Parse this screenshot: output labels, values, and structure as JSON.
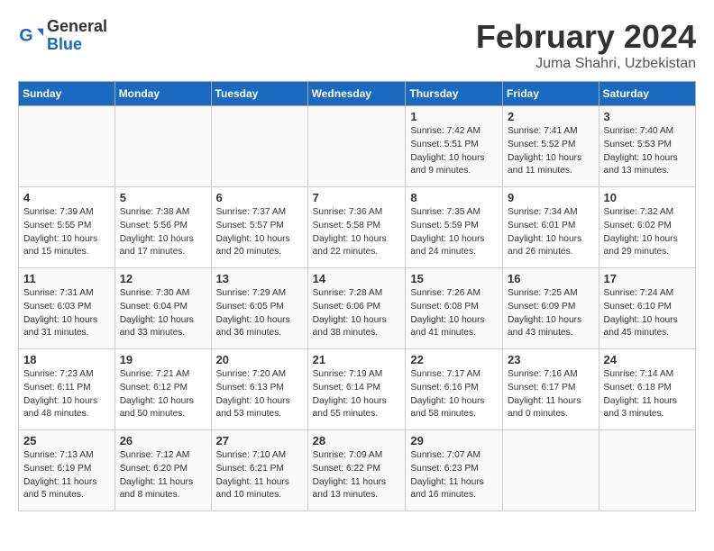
{
  "header": {
    "logo_general": "General",
    "logo_blue": "Blue",
    "month": "February 2024",
    "location": "Juma Shahri, Uzbekistan"
  },
  "weekdays": [
    "Sunday",
    "Monday",
    "Tuesday",
    "Wednesday",
    "Thursday",
    "Friday",
    "Saturday"
  ],
  "weeks": [
    [
      {
        "day": "",
        "info": ""
      },
      {
        "day": "",
        "info": ""
      },
      {
        "day": "",
        "info": ""
      },
      {
        "day": "",
        "info": ""
      },
      {
        "day": "1",
        "info": "Sunrise: 7:42 AM\nSunset: 5:51 PM\nDaylight: 10 hours\nand 9 minutes."
      },
      {
        "day": "2",
        "info": "Sunrise: 7:41 AM\nSunset: 5:52 PM\nDaylight: 10 hours\nand 11 minutes."
      },
      {
        "day": "3",
        "info": "Sunrise: 7:40 AM\nSunset: 5:53 PM\nDaylight: 10 hours\nand 13 minutes."
      }
    ],
    [
      {
        "day": "4",
        "info": "Sunrise: 7:39 AM\nSunset: 5:55 PM\nDaylight: 10 hours\nand 15 minutes."
      },
      {
        "day": "5",
        "info": "Sunrise: 7:38 AM\nSunset: 5:56 PM\nDaylight: 10 hours\nand 17 minutes."
      },
      {
        "day": "6",
        "info": "Sunrise: 7:37 AM\nSunset: 5:57 PM\nDaylight: 10 hours\nand 20 minutes."
      },
      {
        "day": "7",
        "info": "Sunrise: 7:36 AM\nSunset: 5:58 PM\nDaylight: 10 hours\nand 22 minutes."
      },
      {
        "day": "8",
        "info": "Sunrise: 7:35 AM\nSunset: 5:59 PM\nDaylight: 10 hours\nand 24 minutes."
      },
      {
        "day": "9",
        "info": "Sunrise: 7:34 AM\nSunset: 6:01 PM\nDaylight: 10 hours\nand 26 minutes."
      },
      {
        "day": "10",
        "info": "Sunrise: 7:32 AM\nSunset: 6:02 PM\nDaylight: 10 hours\nand 29 minutes."
      }
    ],
    [
      {
        "day": "11",
        "info": "Sunrise: 7:31 AM\nSunset: 6:03 PM\nDaylight: 10 hours\nand 31 minutes."
      },
      {
        "day": "12",
        "info": "Sunrise: 7:30 AM\nSunset: 6:04 PM\nDaylight: 10 hours\nand 33 minutes."
      },
      {
        "day": "13",
        "info": "Sunrise: 7:29 AM\nSunset: 6:05 PM\nDaylight: 10 hours\nand 36 minutes."
      },
      {
        "day": "14",
        "info": "Sunrise: 7:28 AM\nSunset: 6:06 PM\nDaylight: 10 hours\nand 38 minutes."
      },
      {
        "day": "15",
        "info": "Sunrise: 7:26 AM\nSunset: 6:08 PM\nDaylight: 10 hours\nand 41 minutes."
      },
      {
        "day": "16",
        "info": "Sunrise: 7:25 AM\nSunset: 6:09 PM\nDaylight: 10 hours\nand 43 minutes."
      },
      {
        "day": "17",
        "info": "Sunrise: 7:24 AM\nSunset: 6:10 PM\nDaylight: 10 hours\nand 45 minutes."
      }
    ],
    [
      {
        "day": "18",
        "info": "Sunrise: 7:23 AM\nSunset: 6:11 PM\nDaylight: 10 hours\nand 48 minutes."
      },
      {
        "day": "19",
        "info": "Sunrise: 7:21 AM\nSunset: 6:12 PM\nDaylight: 10 hours\nand 50 minutes."
      },
      {
        "day": "20",
        "info": "Sunrise: 7:20 AM\nSunset: 6:13 PM\nDaylight: 10 hours\nand 53 minutes."
      },
      {
        "day": "21",
        "info": "Sunrise: 7:19 AM\nSunset: 6:14 PM\nDaylight: 10 hours\nand 55 minutes."
      },
      {
        "day": "22",
        "info": "Sunrise: 7:17 AM\nSunset: 6:16 PM\nDaylight: 10 hours\nand 58 minutes."
      },
      {
        "day": "23",
        "info": "Sunrise: 7:16 AM\nSunset: 6:17 PM\nDaylight: 11 hours\nand 0 minutes."
      },
      {
        "day": "24",
        "info": "Sunrise: 7:14 AM\nSunset: 6:18 PM\nDaylight: 11 hours\nand 3 minutes."
      }
    ],
    [
      {
        "day": "25",
        "info": "Sunrise: 7:13 AM\nSunset: 6:19 PM\nDaylight: 11 hours\nand 5 minutes."
      },
      {
        "day": "26",
        "info": "Sunrise: 7:12 AM\nSunset: 6:20 PM\nDaylight: 11 hours\nand 8 minutes."
      },
      {
        "day": "27",
        "info": "Sunrise: 7:10 AM\nSunset: 6:21 PM\nDaylight: 11 hours\nand 10 minutes."
      },
      {
        "day": "28",
        "info": "Sunrise: 7:09 AM\nSunset: 6:22 PM\nDaylight: 11 hours\nand 13 minutes."
      },
      {
        "day": "29",
        "info": "Sunrise: 7:07 AM\nSunset: 6:23 PM\nDaylight: 11 hours\nand 16 minutes."
      },
      {
        "day": "",
        "info": ""
      },
      {
        "day": "",
        "info": ""
      }
    ]
  ]
}
